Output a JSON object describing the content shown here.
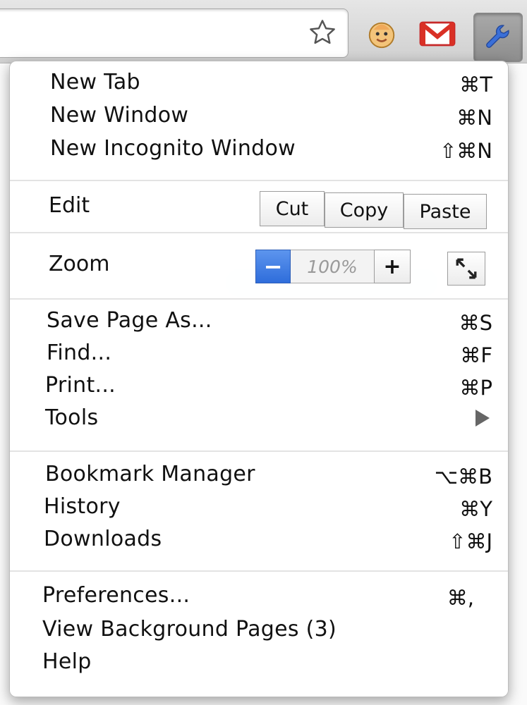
{
  "menu": {
    "section1": [
      {
        "label": "New Tab",
        "shortcut": "⌘T"
      },
      {
        "label": "New Window",
        "shortcut": "⌘N"
      },
      {
        "label": "New Incognito Window",
        "shortcut": "⇧⌘N"
      }
    ],
    "edit": {
      "label": "Edit",
      "cut": "Cut",
      "copy": "Copy",
      "paste": "Paste"
    },
    "zoom": {
      "label": "Zoom",
      "minus": "−",
      "value": "100%",
      "plus": "+"
    },
    "section3": [
      {
        "label": "Save Page As...",
        "shortcut": "⌘S"
      },
      {
        "label": "Find...",
        "shortcut": "⌘F"
      },
      {
        "label": "Print...",
        "shortcut": "⌘P"
      },
      {
        "label": "Tools",
        "shortcut": ""
      }
    ],
    "section4": [
      {
        "label": "Bookmark Manager",
        "shortcut": "⌥⌘B"
      },
      {
        "label": "History",
        "shortcut": "⌘Y"
      },
      {
        "label": "Downloads",
        "shortcut": "⇧⌘J"
      }
    ],
    "section5": [
      {
        "label": "Preferences...",
        "shortcut": "⌘,"
      },
      {
        "label": "View Background Pages (3)",
        "shortcut": ""
      },
      {
        "label": "Help",
        "shortcut": ""
      }
    ]
  },
  "toolbar": {
    "icons": [
      "star-icon",
      "smiley-extension-icon",
      "gmail-icon",
      "wrench-icon"
    ]
  },
  "colors": {
    "zoom_minus": "#2f6ddb",
    "wrench_bg": "#9a9a9a",
    "gmail_red": "#d93025"
  }
}
